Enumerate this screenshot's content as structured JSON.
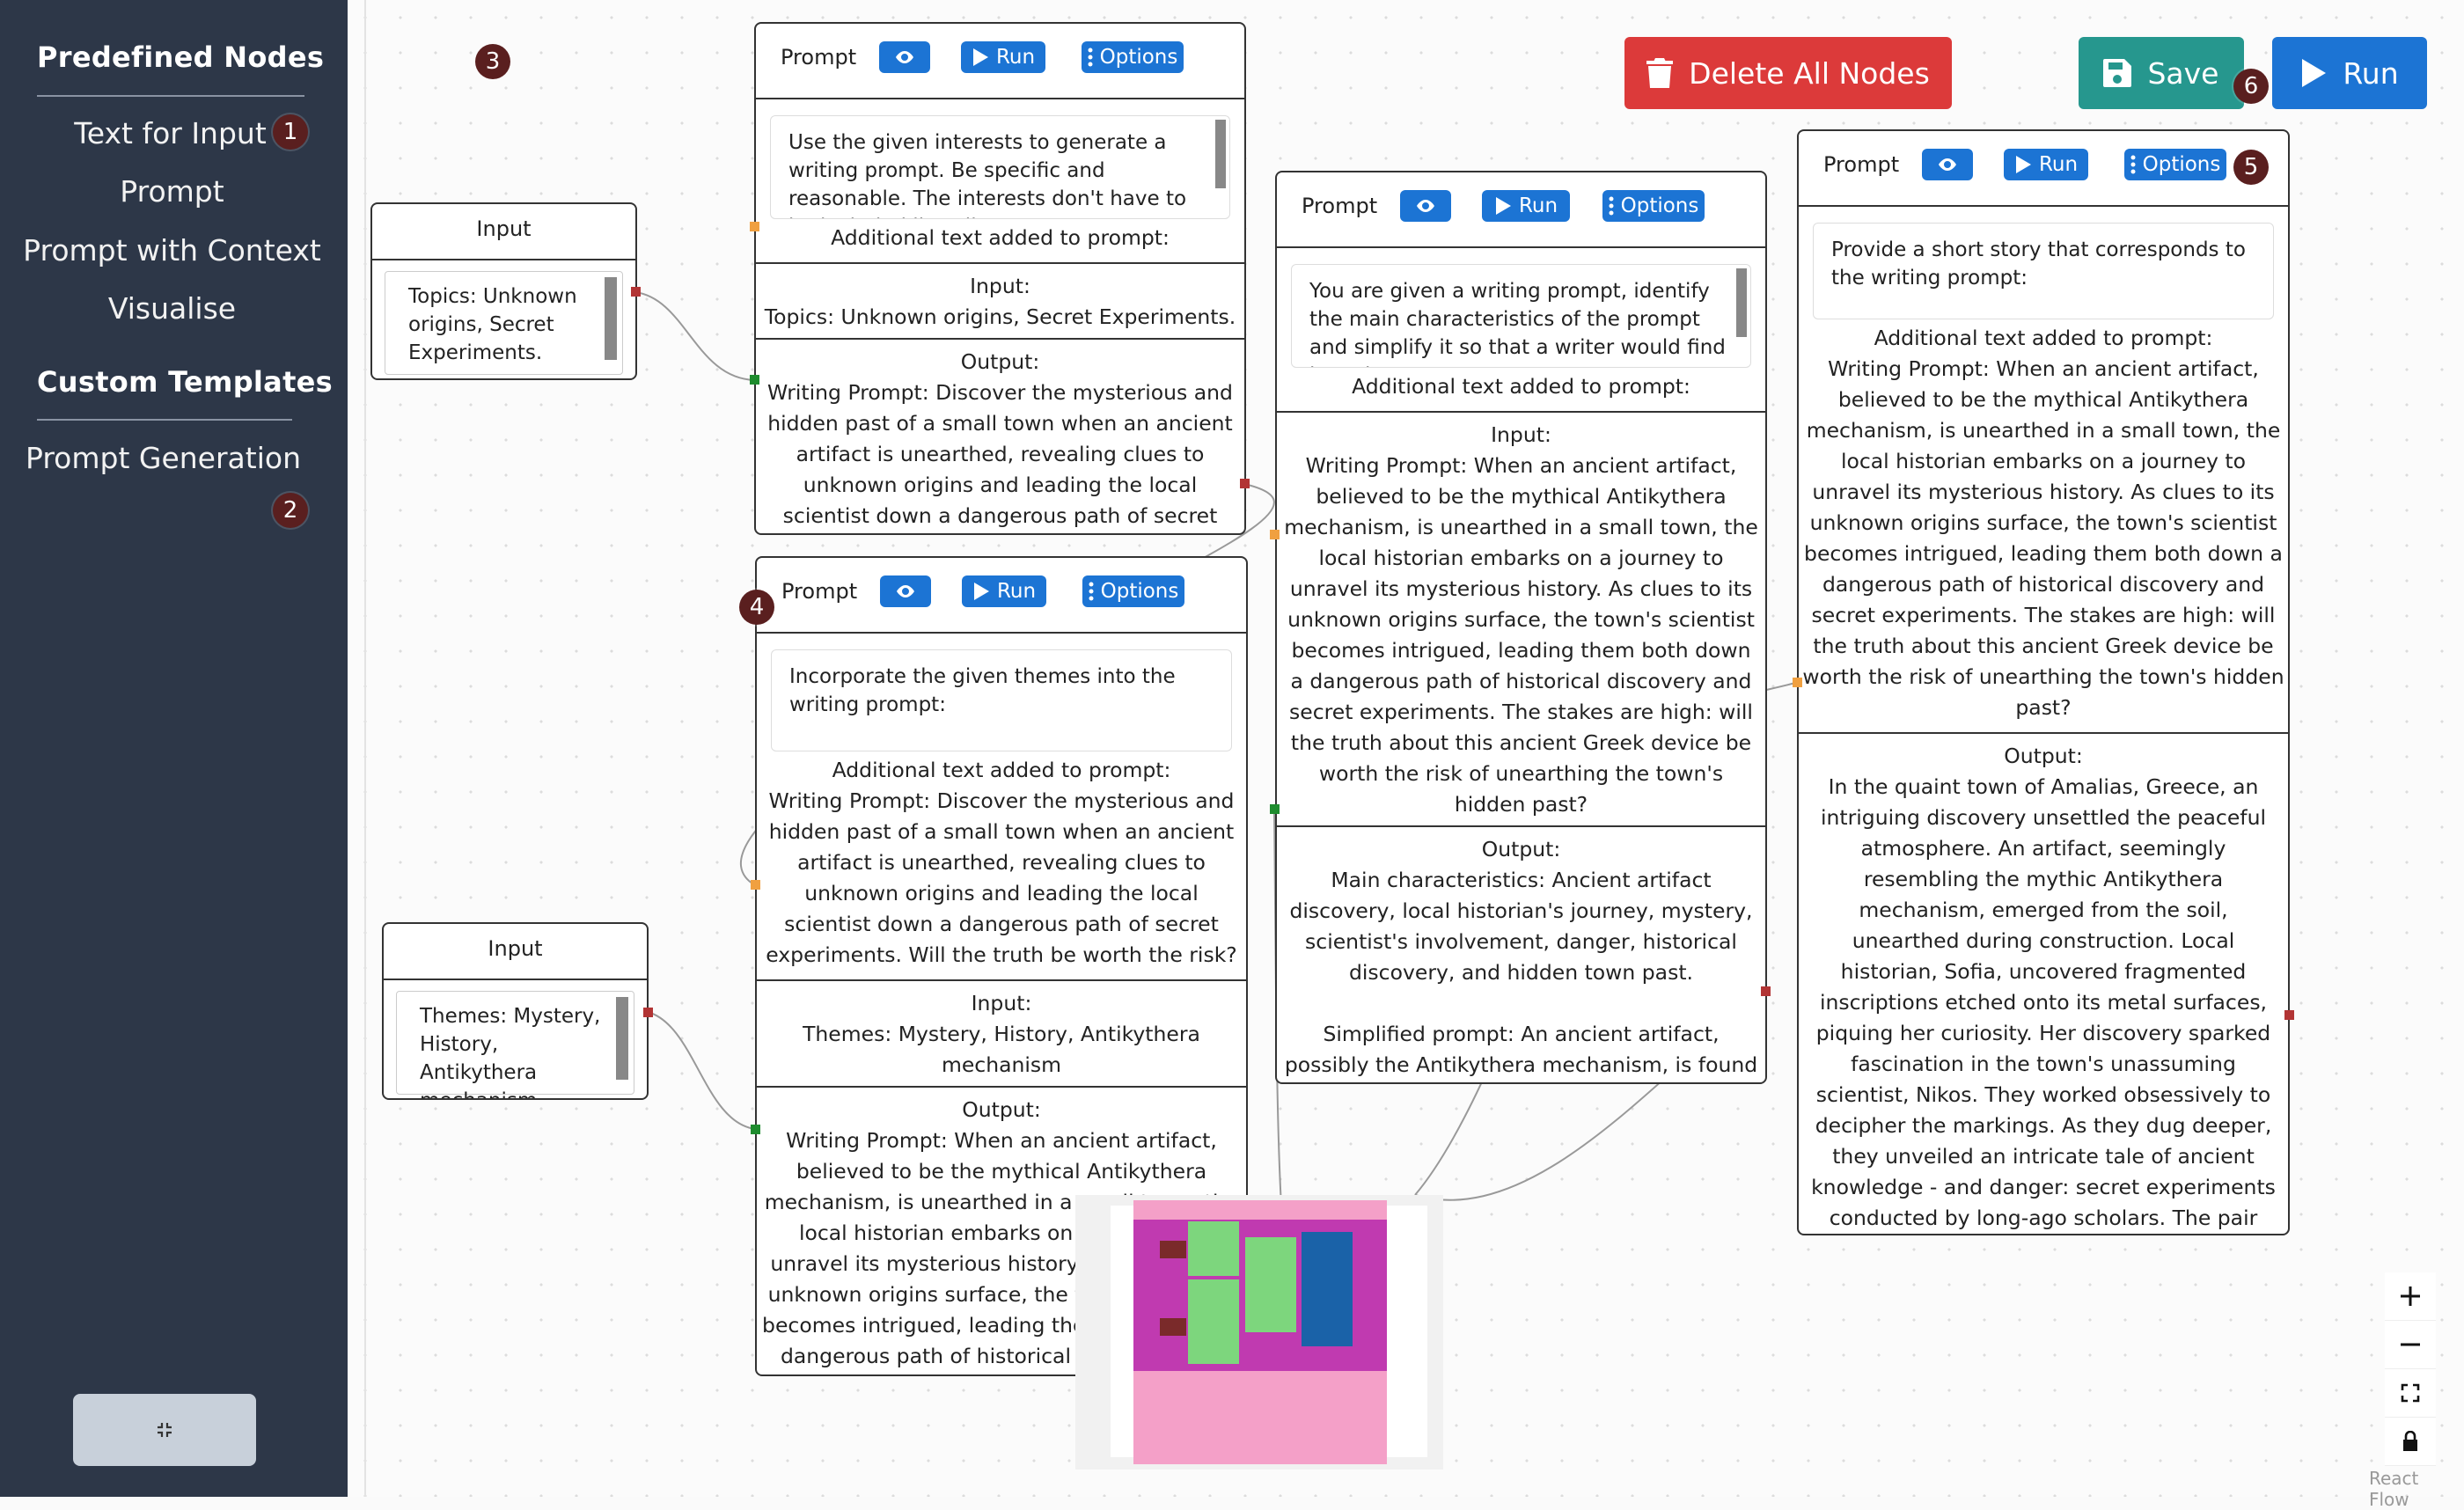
{
  "sidebar": {
    "predefined_heading": "Predefined Nodes",
    "items": [
      {
        "label": "Text for Input"
      },
      {
        "label": "Prompt"
      },
      {
        "label": "Prompt with Context"
      },
      {
        "label": "Visualise"
      }
    ],
    "custom_heading": "Custom Templates",
    "custom_items": [
      {
        "label": "Prompt Generation"
      }
    ]
  },
  "badges": [
    "1",
    "2",
    "3",
    "4",
    "5",
    "6"
  ],
  "toolbar": {
    "delete_all": "Delete All Nodes",
    "save": "Save",
    "run": "Run",
    "colors": {
      "delete": "#dc3a3a",
      "save": "#26978e",
      "run": "#1c74d4"
    }
  },
  "node_buttons": {
    "run": "Run",
    "options": "Options"
  },
  "nodes": {
    "input1": {
      "title": "Input",
      "text": "Topics: Unknown origins, Secret Experiments."
    },
    "input2": {
      "title": "Input",
      "text": "Themes: Mystery, History, Antikythera mechanism"
    },
    "prompt1": {
      "title": "Prompt",
      "prompt": "Use the given interests to generate a writing prompt. Be specific and reasonable. The interests don't have to be included literally,",
      "additional_label": "Additional text added to prompt:",
      "input_label": "Input:",
      "input": "Topics: Unknown origins, Secret Experiments.",
      "output_label": "Output:",
      "output": "Writing Prompt: Discover the mysterious and hidden past of a small town when an ancient artifact is unearthed, revealing clues to unknown origins and leading the local scientist down a dangerous path of secret experiments. Will the truth be worth the risk?"
    },
    "prompt2": {
      "title": "Prompt",
      "prompt": "Incorporate the given themes into the writing prompt:",
      "additional_label": "Additional text added to prompt:",
      "additional": "Writing Prompt: Discover the mysterious and hidden past of a small town when an ancient artifact is unearthed, revealing clues to unknown origins and leading the local scientist down a dangerous path of secret experiments. Will the truth be worth the risk?",
      "input_label": "Input:",
      "input": "Themes: Mystery, History, Antikythera mechanism",
      "output_label": "Output:",
      "output": "Writing Prompt: When an ancient artifact, believed to be the mythical Antikythera mechanism, is unearthed in a small town, the local historian embarks on a journey to unravel its mysterious history. As clues to its unknown origins surface, the town's scientist becomes intrigued, leading them both down a dangerous path of historical discovery and secret experiments. The stakes are high: will the truth about this ancient Greek device be worth the risk of unearthing the town's hidden past?"
    },
    "prompt3": {
      "title": "Prompt",
      "prompt": "You are given a writing prompt, identify the main characteristics of the prompt and simplify it so that a writer would find it easier",
      "additional_label": "Additional text added to prompt:",
      "input_label": "Input:",
      "input": "Writing Prompt: When an ancient artifact, believed to be the mythical Antikythera mechanism, is unearthed in a small town, the local historian embarks on a journey to unravel its mysterious history. As clues to its unknown origins surface, the town's scientist becomes intrigued, leading them both down a dangerous path of historical discovery and secret experiments. The stakes are high: will the truth about this ancient Greek device be worth the risk of unearthing the town's hidden past?",
      "output_label": "Output:",
      "output_characteristics": "Main characteristics: Ancient artifact discovery, local historian's journey, mystery, scientist's involvement, danger, historical discovery, and hidden town past.",
      "output_simplified": "Simplified prompt: An ancient artifact, possibly the Antikythera mechanism, is found in a small town. The historian and scientist team up to uncover its origin, leading to dangerous discoveries about the town's history."
    },
    "prompt4": {
      "title": "Prompt",
      "prompt": "Provide a short story that corresponds to the writing prompt:",
      "additional_label": "Additional text added to prompt:",
      "additional": "Writing Prompt: When an ancient artifact, believed to be the mythical Antikythera mechanism, is unearthed in a small town, the local historian embarks on a journey to unravel its mysterious history. As clues to its unknown origins surface, the town's scientist becomes intrigued, leading them both down a dangerous path of historical discovery and secret experiments. The stakes are high: will the truth about this ancient Greek device be worth the risk of unearthing the town's hidden past?",
      "output_label": "Output:",
      "output": "In the quaint town of Amalias, Greece, an intriguing discovery unsettled the peaceful atmosphere. An artifact, seemingly resembling the mythic Antikythera mechanism, emerged from the soil, unearthed during construction. Local historian, Sofia, uncovered fragmented inscriptions etched onto its metal surfaces, piquing her curiosity. Her discovery sparked fascination in the town's unassuming scientist, Nikos. They worked obsessively to decipher the markings. As they dug deeper, they unveiled an intricate tale of ancient knowledge - and danger: secret experiments conducted by long-ago scholars. The pair tread carefully on their historical odyssey; every new revelation raised thrilling questions. Each late night peek into the past held intrigue. Their mission continued, as truth was sweet despite the hidden threats."
    }
  },
  "zoom_controls": [
    "plus-icon",
    "minus-icon",
    "fit-view-icon",
    "lock-icon"
  ],
  "attribution": "React Flow"
}
